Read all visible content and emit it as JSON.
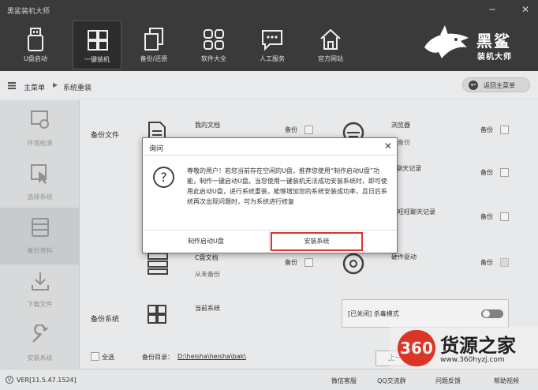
{
  "app": {
    "title": "黑鲨装机大师"
  },
  "toolbar": {
    "items": [
      {
        "label": "U盘启动"
      },
      {
        "label": "一键装机"
      },
      {
        "label": "备份/还原"
      },
      {
        "label": "软件大全"
      },
      {
        "label": "人工服务"
      },
      {
        "label": "官方网站"
      }
    ],
    "brand_top": "黑鲨",
    "brand_bottom": "装机大师"
  },
  "breadcrumb": {
    "home": "主菜单",
    "current": "系统重装",
    "back_button": "返回主菜单"
  },
  "leftnav": {
    "items": [
      {
        "label": "环境检测"
      },
      {
        "label": "选择系统"
      },
      {
        "label": "备份资料"
      },
      {
        "label": "下载文件"
      },
      {
        "label": "安装系统"
      }
    ]
  },
  "content": {
    "backup_files_label": "备份文件",
    "backup_system_label": "备份系统",
    "items": {
      "my_docs": {
        "name": "我的文档",
        "backup": "备份"
      },
      "c_docs": {
        "name": "C盘文档",
        "sub": "从未备份",
        "backup": "备份"
      },
      "current_system": {
        "name": "当前系统"
      },
      "browser": {
        "name": "浏览器",
        "sub": "未备份",
        "backup": "备份"
      },
      "qq": {
        "name": "Q聊天记录",
        "backup": "备份"
      },
      "wangwang": {
        "name": "里旺旺聊天记录",
        "backup": "备份"
      },
      "driver": {
        "name": "硬件驱动",
        "backup": "备份"
      }
    },
    "antivirus": "[已关闭] 杀毒模式",
    "select_all": "全选",
    "backup_dir_label": "备份目录：",
    "backup_dir": "D:\\heisha\\heisha\\bak\\",
    "next_button": "上一"
  },
  "dialog": {
    "title": "询问",
    "message": "尊敬的用户！若您当前存在空闲的U盘，推荐您使用“制作启动U盘”功能，制作一键启动U盘。当您使用一键装机无法成功安装系统时，即可使用此启动U盘，进行系统重装，能够增加您的系统安装成功率，且日后系统再次出现问题时，可为系统进行修复",
    "button_make_usb": "制作启动U盘",
    "button_install": "安装系统"
  },
  "status": {
    "version": "VER[11.5.47.1524]",
    "wechat": "微信客服",
    "qq_group": "QQ交流群",
    "feedback": "问题反馈",
    "tutorial": "帮助视频"
  },
  "watermark": {
    "badge": "360",
    "title": "货源之家",
    "url": "www.360hyzj.com"
  }
}
